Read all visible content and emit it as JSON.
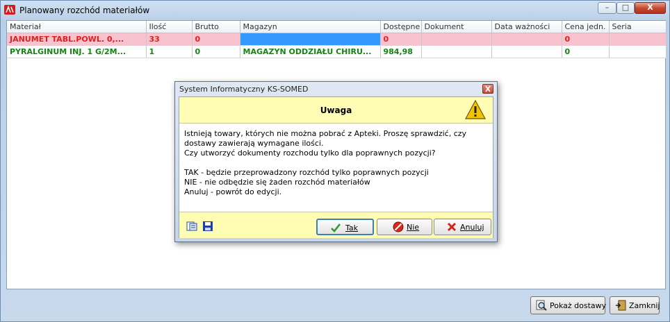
{
  "window": {
    "title": "Planowany rozchód materiałów",
    "min_glyph": "–",
    "max_glyph": "□",
    "close_glyph": "X"
  },
  "grid": {
    "columns": [
      "Materiał",
      "Ilość",
      "Brutto",
      "Magazyn",
      "Dostępne",
      "Dokument",
      "Data ważności",
      "Cena jedn.",
      "Seria"
    ],
    "rows": [
      {
        "material": "JANUMET TABL.POWL. 0,...",
        "ilosc": "33",
        "brutto": "0",
        "magazyn": "",
        "dostepne": "0",
        "dokument": "",
        "data": "",
        "cena": "0",
        "seria": ""
      },
      {
        "material": "PYRALGINUM INJ. 1 G/2M...",
        "ilosc": "1",
        "brutto": "0",
        "magazyn": "MAGAZYN ODDZIAŁU CHIRU...",
        "dostepne": "984,98",
        "dokument": "",
        "data": "",
        "cena": "0",
        "seria": ""
      }
    ],
    "colors": {
      "error_row_bg": "#f9c2cf",
      "error_text": "#e0201c",
      "ok_text": "#148414",
      "selected_cell": "#3399ff"
    }
  },
  "bottom": {
    "show_deliveries": "Pokaż dostawy",
    "close": "Zamknij"
  },
  "dialog": {
    "title": "System Informatyczny KS-SOMED",
    "header": "Uwaga",
    "lines": [
      "Istnieją towary, których nie można pobrać z Apteki. Proszę sprawdzić, czy",
      "dostawy zawierają wymagane ilości.",
      "Czy utworzyć dokumenty rozchodu tylko dla poprawnych pozycji?",
      "",
      "TAK - będzie przeprowadzony rozchód tylko poprawnych pozycji",
      "NIE - nie odbędzie się żaden rozchód materiałów",
      "Anuluj - powrót do edycji."
    ],
    "buttons": {
      "yes": "Tak",
      "no": "Nie",
      "cancel": "Anuluj"
    },
    "icons": [
      "copy-icon",
      "save-icon",
      "warning-icon"
    ]
  }
}
